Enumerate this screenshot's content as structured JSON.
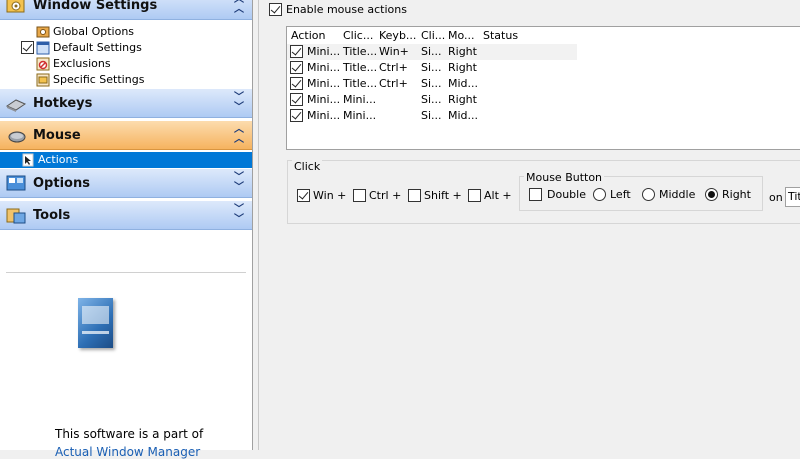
{
  "sidebar": {
    "groups": [
      {
        "label": "Window Settings",
        "icon": "window-settings-icon",
        "state": "expanded",
        "active": false
      },
      {
        "label": "Hotkeys",
        "icon": "keyboard-icon",
        "state": "collapsed",
        "active": false
      },
      {
        "label": "Mouse",
        "icon": "mouse-icon",
        "state": "expanded",
        "active": true
      },
      {
        "label": "Options",
        "icon": "options-icon",
        "state": "collapsed",
        "active": false
      },
      {
        "label": "Tools",
        "icon": "tools-icon",
        "state": "collapsed",
        "active": false
      }
    ],
    "window_items": [
      {
        "label": "Global Options",
        "icon": "global-options-icon"
      },
      {
        "label": "Default Settings",
        "icon": "window-icon",
        "checked": true
      },
      {
        "label": "Exclusions",
        "icon": "exclusions-icon"
      },
      {
        "label": "Specific Settings",
        "icon": "specific-settings-icon"
      }
    ],
    "mouse_items": [
      {
        "label": "Actions",
        "icon": "actions-icon",
        "selected": true
      }
    ],
    "promo_text": "This software is a part of",
    "promo_link": "Actual Window Manager"
  },
  "main": {
    "enable_label": "Enable mouse actions",
    "enable_checked": true,
    "columns": [
      "Action",
      "Clic...",
      "Keyb...",
      "Cli...",
      "Mo...",
      "Status"
    ],
    "rows": [
      {
        "checked": true,
        "cells": [
          "Mini...",
          "Title...",
          "Win+",
          "Si...",
          "Right",
          ""
        ]
      },
      {
        "checked": true,
        "cells": [
          "Mini...",
          "Title...",
          "Ctrl+",
          "Si...",
          "Right",
          ""
        ]
      },
      {
        "checked": true,
        "cells": [
          "Mini...",
          "Title...",
          "Ctrl+",
          "Si...",
          "Mid...",
          ""
        ]
      },
      {
        "checked": true,
        "cells": [
          "Mini...",
          "Mini...",
          "",
          "Si...",
          "Right",
          ""
        ]
      },
      {
        "checked": true,
        "cells": [
          "Mini...",
          "Mini...",
          "",
          "Si...",
          "Mid...",
          ""
        ]
      }
    ],
    "click_group_label": "Click",
    "modifiers": [
      {
        "label": "Win +",
        "checked": true
      },
      {
        "label": "Ctrl +",
        "checked": false
      },
      {
        "label": "Shift +",
        "checked": false
      },
      {
        "label": "Alt +",
        "checked": false
      }
    ],
    "mouse_button_label": "Mouse Button",
    "double_label": "Double",
    "double_checked": false,
    "buttons": [
      {
        "label": "Left",
        "selected": false
      },
      {
        "label": "Middle",
        "selected": false
      },
      {
        "label": "Right",
        "selected": true
      }
    ],
    "on_label": "on",
    "on_value": "Title"
  }
}
